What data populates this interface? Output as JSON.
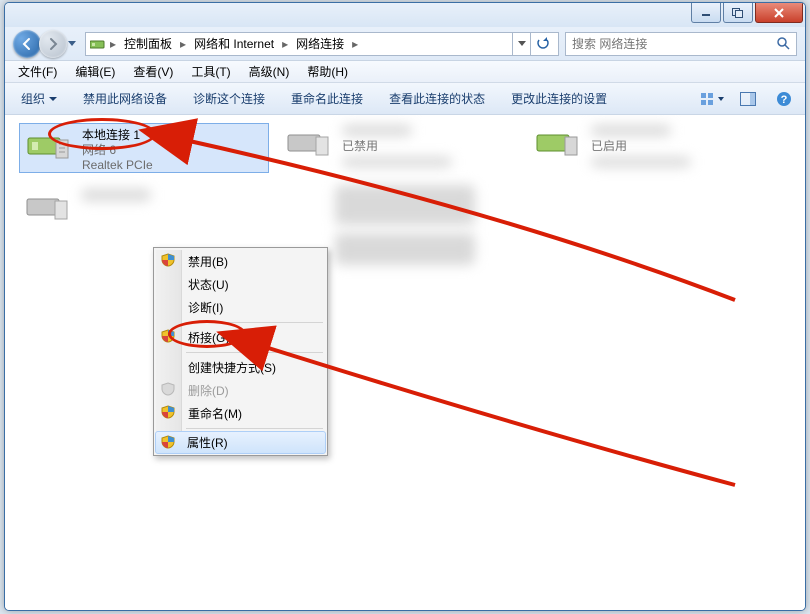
{
  "breadcrumb": {
    "items": [
      "控制面板",
      "网络和 Internet",
      "网络连接"
    ]
  },
  "search": {
    "placeholder": "搜索 网络连接"
  },
  "menu": {
    "file": "文件(F)",
    "edit": "编辑(E)",
    "view": "查看(V)",
    "tools": "工具(T)",
    "advanced": "高级(N)",
    "help": "帮助(H)"
  },
  "toolbar": {
    "organize": "组织",
    "disable": "禁用此网络设备",
    "diagnose": "诊断这个连接",
    "rename": "重命名此连接",
    "status": "查看此连接的状态",
    "settings": "更改此连接的设置"
  },
  "connections": {
    "selected": {
      "title": "本地连接 1",
      "line2": "网络 6",
      "line3": "Realtek PCIe"
    },
    "col2": {
      "status": "已禁用"
    },
    "col3": {
      "status": "已启用"
    }
  },
  "contextmenu": {
    "disable": "禁用(B)",
    "status": "状态(U)",
    "diagnose": "诊断(I)",
    "bridge": "桥接(G)",
    "shortcut": "创建快捷方式(S)",
    "delete": "删除(D)",
    "rename": "重命名(M)",
    "properties": "属性(R)"
  }
}
